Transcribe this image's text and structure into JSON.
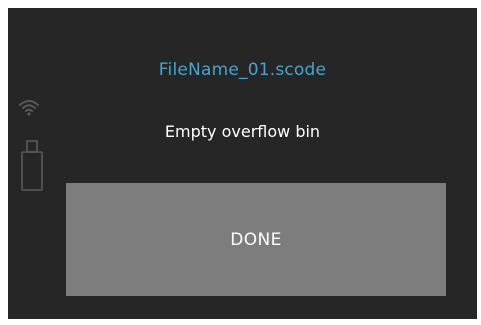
{
  "dialog": {
    "filename": "FileName_01.scode",
    "message": "Empty overflow bin",
    "done_label": "DONE"
  },
  "status_icons": {
    "wifi": "wifi-icon",
    "usb": "usb-drive-icon"
  },
  "colors": {
    "background": "#262626",
    "filename_text": "#46a4cf",
    "message_text": "#ffffff",
    "button_bg": "#7d7d7d",
    "icon": "#5a5a5a"
  }
}
